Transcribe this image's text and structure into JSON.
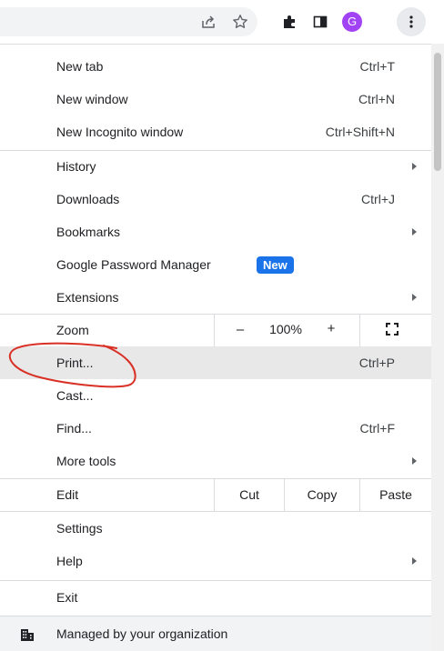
{
  "toolbar": {
    "icons": [
      "share-icon",
      "bookmark-star-icon",
      "extensions-puzzle-icon",
      "side-panel-icon",
      "profile-avatar",
      "menu-kebab-icon"
    ],
    "avatar_letter": "G",
    "avatar_color": "#a142f4"
  },
  "menu": {
    "new_tab": {
      "label": "New tab",
      "shortcut": "Ctrl+T"
    },
    "new_window": {
      "label": "New window",
      "shortcut": "Ctrl+N"
    },
    "new_incognito": {
      "label": "New Incognito window",
      "shortcut": "Ctrl+Shift+N"
    },
    "history": {
      "label": "History"
    },
    "downloads": {
      "label": "Downloads",
      "shortcut": "Ctrl+J"
    },
    "bookmarks": {
      "label": "Bookmarks"
    },
    "password_manager": {
      "label": "Google Password Manager",
      "badge": "New"
    },
    "extensions": {
      "label": "Extensions"
    },
    "zoom": {
      "label": "Zoom",
      "minus": "–",
      "value": "100%",
      "plus": "+"
    },
    "print": {
      "label": "Print...",
      "shortcut": "Ctrl+P"
    },
    "cast": {
      "label": "Cast..."
    },
    "find": {
      "label": "Find...",
      "shortcut": "Ctrl+F"
    },
    "more_tools": {
      "label": "More tools"
    },
    "edit": {
      "label": "Edit",
      "cut": "Cut",
      "copy": "Copy",
      "paste": "Paste"
    },
    "settings": {
      "label": "Settings"
    },
    "help": {
      "label": "Help"
    },
    "exit": {
      "label": "Exit"
    },
    "managed": {
      "label": "Managed by your organization"
    }
  },
  "colors": {
    "accent": "#1a73e8",
    "annotation": "#d93025",
    "hover_row": "#e8e8e9"
  }
}
